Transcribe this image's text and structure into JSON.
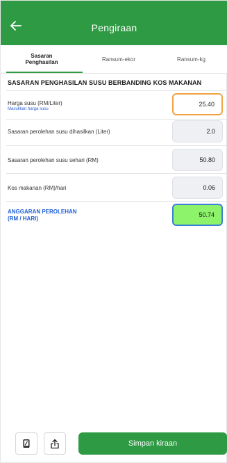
{
  "header": {
    "title": "Pengiraan",
    "back_icon": "arrow-left-icon"
  },
  "tabs": [
    {
      "label_line1": "Sasaran",
      "label_line2": "Penghasilan",
      "active": true
    },
    {
      "label": "Ransum-ekor",
      "active": false
    },
    {
      "label": "Ransum-kg",
      "active": false
    }
  ],
  "section": {
    "title": "SASARAN PENGHASILAN SUSU BERBANDING KOS MAKANAN"
  },
  "rows": {
    "milk_price": {
      "label": "Harga susu (RM/Liter)",
      "hint": "Masukkan harga susu",
      "value": "25.40"
    },
    "milk_target": {
      "label": "Sasaran perolehan susu dihasilkan (Liter)",
      "value": "2.0"
    },
    "daily_target": {
      "label": "Sasaran perolehan susu sehari (RM)",
      "value": "50.80"
    },
    "feed_cost": {
      "label": "Kos makanan (RM)/hari",
      "value": "0.06"
    },
    "estimate": {
      "label_line1": "ANGGARAN PEROLEHAN",
      "label_line2": "(RM / HARI)",
      "value": "50.74"
    }
  },
  "footer": {
    "save_label": "Simpan kiraan",
    "icon1": "phone-icon",
    "icon2": "share-icon"
  },
  "colors": {
    "primary": "#2e9a43",
    "active_border": "#f0a341",
    "result_fill": "#8cf36b",
    "result_border": "#3c7fd8",
    "hint_text": "#2b5fd6"
  }
}
